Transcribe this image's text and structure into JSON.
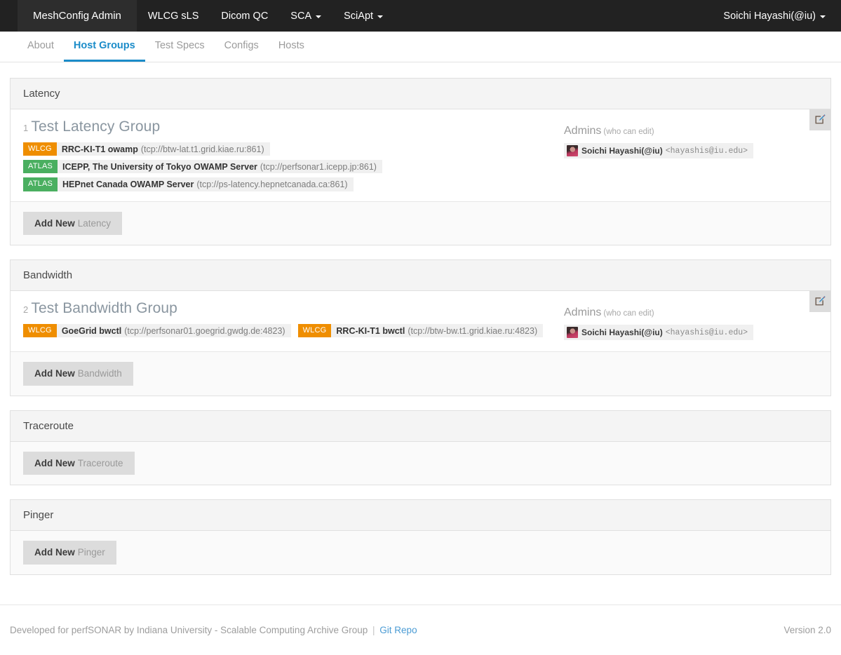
{
  "navbar": {
    "brand": "MeshConfig Admin",
    "links": [
      {
        "label": "WLCG sLS",
        "caret": false
      },
      {
        "label": "Dicom QC",
        "caret": false
      },
      {
        "label": "SCA",
        "caret": true
      },
      {
        "label": "SciApt",
        "caret": true
      }
    ],
    "user": "Soichi Hayashi(@iu)"
  },
  "tabs": [
    {
      "label": "About",
      "active": false
    },
    {
      "label": "Host Groups",
      "active": true
    },
    {
      "label": "Test Specs",
      "active": false
    },
    {
      "label": "Configs",
      "active": false
    },
    {
      "label": "Hosts",
      "active": false
    }
  ],
  "admins_label": "Admins",
  "admins_hint": "(who can edit)",
  "add_new_prefix": "Add New",
  "edit_icon": "edit-pencil-square-icon",
  "colors": {
    "brand_orange": "#ef8e00",
    "badge_green": "#4aaf60",
    "accent_blue": "#1b8cc9",
    "navbar_dark": "#222222"
  },
  "panels": [
    {
      "title": "Latency",
      "add_new_kind": "Latency",
      "groups": [
        {
          "number": "1",
          "name": "Test Latency Group",
          "layout": "stacked",
          "hosts": [
            {
              "badge": "WLCG",
              "name": "RRC-KI-T1 owamp",
              "url": "(tcp://btw-lat.t1.grid.kiae.ru:861)"
            },
            {
              "badge": "ATLAS",
              "name": "ICEPP, The University of Tokyo OWAMP Server",
              "url": "(tcp://perfsonar1.icepp.jp:861)"
            },
            {
              "badge": "ATLAS",
              "name": "HEPnet Canada OWAMP Server",
              "url": "(tcp://ps-latency.hepnetcanada.ca:861)"
            }
          ],
          "admins": [
            {
              "name": "Soichi Hayashi(@iu)",
              "email": "<hayashis@iu.edu>"
            }
          ]
        }
      ]
    },
    {
      "title": "Bandwidth",
      "add_new_kind": "Bandwidth",
      "groups": [
        {
          "number": "2",
          "name": "Test Bandwidth Group",
          "layout": "inline",
          "hosts": [
            {
              "badge": "WLCG",
              "name": "GoeGrid bwctl",
              "url": "(tcp://perfsonar01.goegrid.gwdg.de:4823)"
            },
            {
              "badge": "WLCG",
              "name": "RRC-KI-T1 bwctl",
              "url": "(tcp://btw-bw.t1.grid.kiae.ru:4823)"
            }
          ],
          "admins": [
            {
              "name": "Soichi Hayashi(@iu)",
              "email": "<hayashis@iu.edu>"
            }
          ]
        }
      ]
    },
    {
      "title": "Traceroute",
      "add_new_kind": "Traceroute",
      "groups": []
    },
    {
      "title": "Pinger",
      "add_new_kind": "Pinger",
      "groups": []
    }
  ],
  "footer": {
    "text": "Developed for perfSONAR by Indiana University - Scalable Computing Archive Group",
    "separator": "|",
    "link": "Git Repo",
    "version": "Version 2.0"
  }
}
